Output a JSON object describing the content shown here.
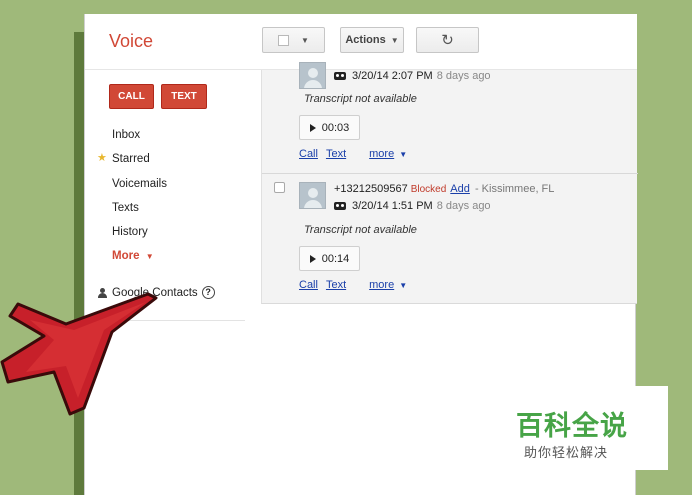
{
  "app": {
    "title": "Voice"
  },
  "toolbar": {
    "actions_label": "Actions",
    "refresh_glyph": "↻"
  },
  "sidebar": {
    "call_label": "CALL",
    "text_label": "TEXT",
    "items": [
      {
        "label": "Inbox"
      },
      {
        "label": "Starred"
      },
      {
        "label": "Voicemails"
      },
      {
        "label": "Texts"
      },
      {
        "label": "History"
      },
      {
        "label": "More"
      }
    ],
    "contacts_label": "Google Contacts",
    "help_glyph": "?"
  },
  "messages": [
    {
      "date": "3/20/14 2:07 PM",
      "ago": "8 days ago",
      "transcript": "Transcript not available",
      "duration": "00:03",
      "links": {
        "call": "Call",
        "text": "Text",
        "more": "more"
      }
    },
    {
      "number": "+13212509567",
      "status": "Blocked",
      "add": "Add",
      "location": "- Kissimmee, FL",
      "date": "3/20/14 1:51 PM",
      "ago": "8 days ago",
      "transcript": "Transcript not available",
      "duration": "00:14",
      "links": {
        "call": "Call",
        "text": "Text",
        "more": "more"
      }
    }
  ],
  "watermark": {
    "title": "百科全说",
    "subtitle": "助你轻松解决"
  },
  "colors": {
    "accent": "#d14836",
    "link": "#1a3fa9",
    "background": "#9fb97a",
    "brand": "#47a447"
  }
}
